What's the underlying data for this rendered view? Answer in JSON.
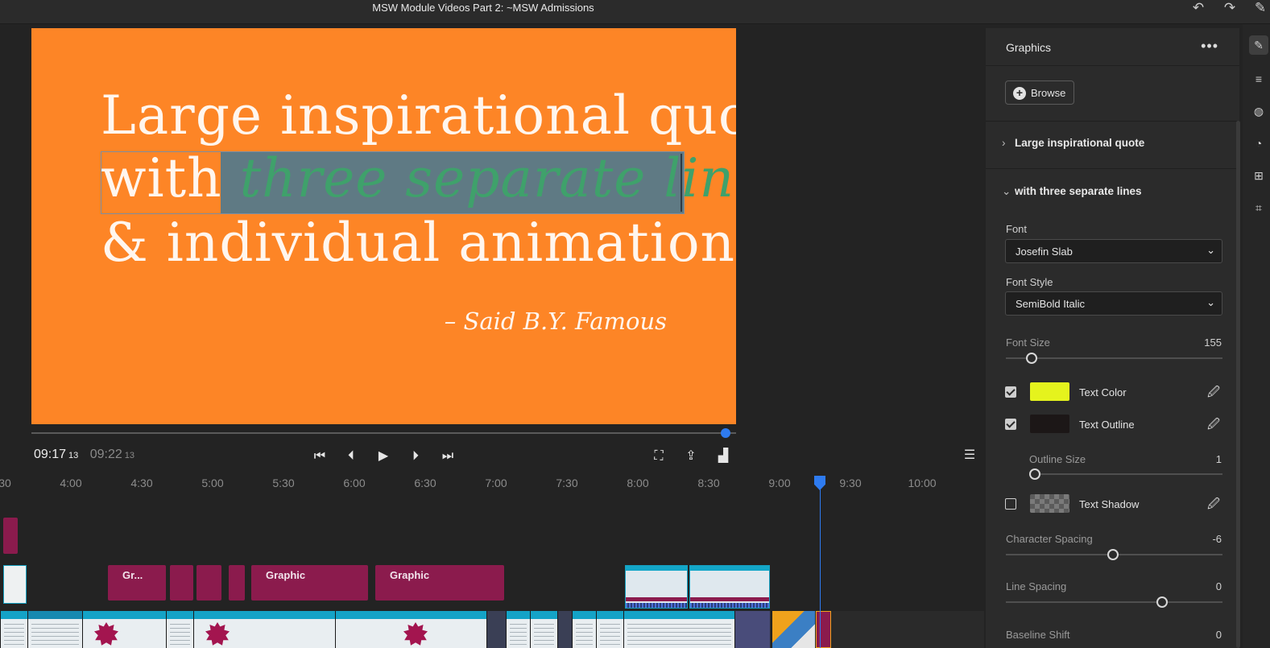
{
  "window": {
    "title": "MSW Module Videos Part 2: ~MSW Admissions"
  },
  "titlebar_icons": {
    "undo": "undo-icon",
    "redo": "redo-icon",
    "comment": "comment-icon"
  },
  "preview": {
    "quote_line1": "Large inspirational quote",
    "quote_line2_plain": "with ",
    "quote_line2_selected": "three separate lines",
    "quote_line3": "& individual animations",
    "attribution": "– Said B.Y. Famous",
    "background_color": "#fd8526",
    "selected_text_color": "#3fa16b",
    "progress_fraction": 0.985
  },
  "transport": {
    "current_time": "09:17",
    "current_frames": "13",
    "duration": "09:22",
    "duration_frames": "13"
  },
  "timeline": {
    "ruler_labels": [
      "30",
      "4:00",
      "4:30",
      "5:00",
      "5:30",
      "6:00",
      "6:30",
      "7:00",
      "7:30",
      "8:00",
      "8:30",
      "9:00",
      "9:30",
      "10:00"
    ],
    "clip_labels": {
      "gr_short": "Gr...",
      "graphic_a": "Graphic",
      "graphic_b": "Graphic"
    },
    "accent": "#8b1b4d",
    "playhead_color": "#2e7bf0"
  },
  "panel": {
    "title": "Graphics",
    "browse_label": "Browse",
    "section_collapsed": "Large inspirational quote",
    "section_expanded": "with three separate lines",
    "font_label": "Font",
    "font_value": "Josefin Slab",
    "font_style_label": "Font Style",
    "font_style_value": "SemiBold Italic",
    "font_size_label": "Font Size",
    "font_size_value": "155",
    "text_color_label": "Text Color",
    "text_color_hex": "#e5f31d",
    "text_color_checked": true,
    "text_outline_label": "Text Outline",
    "text_outline_hex": "#1c1717",
    "text_outline_checked": true,
    "outline_size_label": "Outline Size",
    "outline_size_value": "1",
    "text_shadow_label": "Text Shadow",
    "text_shadow_checked": false,
    "char_spacing_label": "Character Spacing",
    "char_spacing_value": "-6",
    "line_spacing_label": "Line Spacing",
    "line_spacing_value": "0",
    "baseline_shift_label": "Baseline Shift",
    "baseline_shift_value": "0"
  }
}
